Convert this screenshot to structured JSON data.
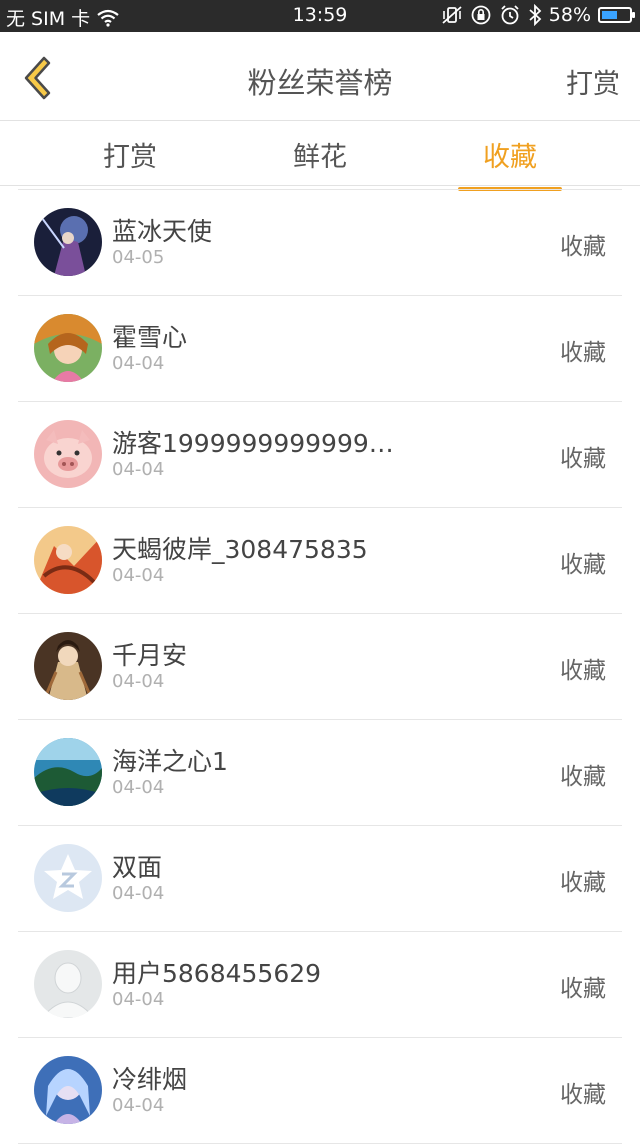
{
  "status_bar": {
    "carrier": "无 SIM 卡",
    "time": "13:59",
    "battery": "58%",
    "battery_level": 0.58
  },
  "header": {
    "title": "粉丝荣誉榜",
    "action_label": "打赏"
  },
  "tabs": [
    {
      "label": "打赏",
      "active": false
    },
    {
      "label": "鲜花",
      "active": false
    },
    {
      "label": "收藏",
      "active": true
    }
  ],
  "colors": {
    "accent": "#f0a020",
    "back_arrow_fill": "#f7c948",
    "back_arrow_stroke": "#4a4a4a"
  },
  "list": [
    {
      "name": "蓝冰天使",
      "date": "04-05",
      "action": "收藏",
      "avatar_style": "dark-fantasy"
    },
    {
      "name": "霍雪心",
      "date": "04-04",
      "action": "收藏",
      "avatar_style": "anime-girl"
    },
    {
      "name": "游客1999999999999…",
      "date": "04-04",
      "action": "收藏",
      "avatar_style": "pig"
    },
    {
      "name": "天蝎彼岸_308475835",
      "date": "04-04",
      "action": "收藏",
      "avatar_style": "orange-warrior"
    },
    {
      "name": "千月安",
      "date": "04-04",
      "action": "收藏",
      "avatar_style": "traditional-lady"
    },
    {
      "name": "海洋之心1",
      "date": "04-04",
      "action": "收藏",
      "avatar_style": "ocean"
    },
    {
      "name": "双面",
      "date": "04-04",
      "action": "收藏",
      "avatar_style": "qzone-star"
    },
    {
      "name": "用户5868455629",
      "date": "04-04",
      "action": "收藏",
      "avatar_style": "default-user"
    },
    {
      "name": "冷绯烟",
      "date": "04-04",
      "action": "收藏",
      "avatar_style": "blue-anime"
    }
  ]
}
